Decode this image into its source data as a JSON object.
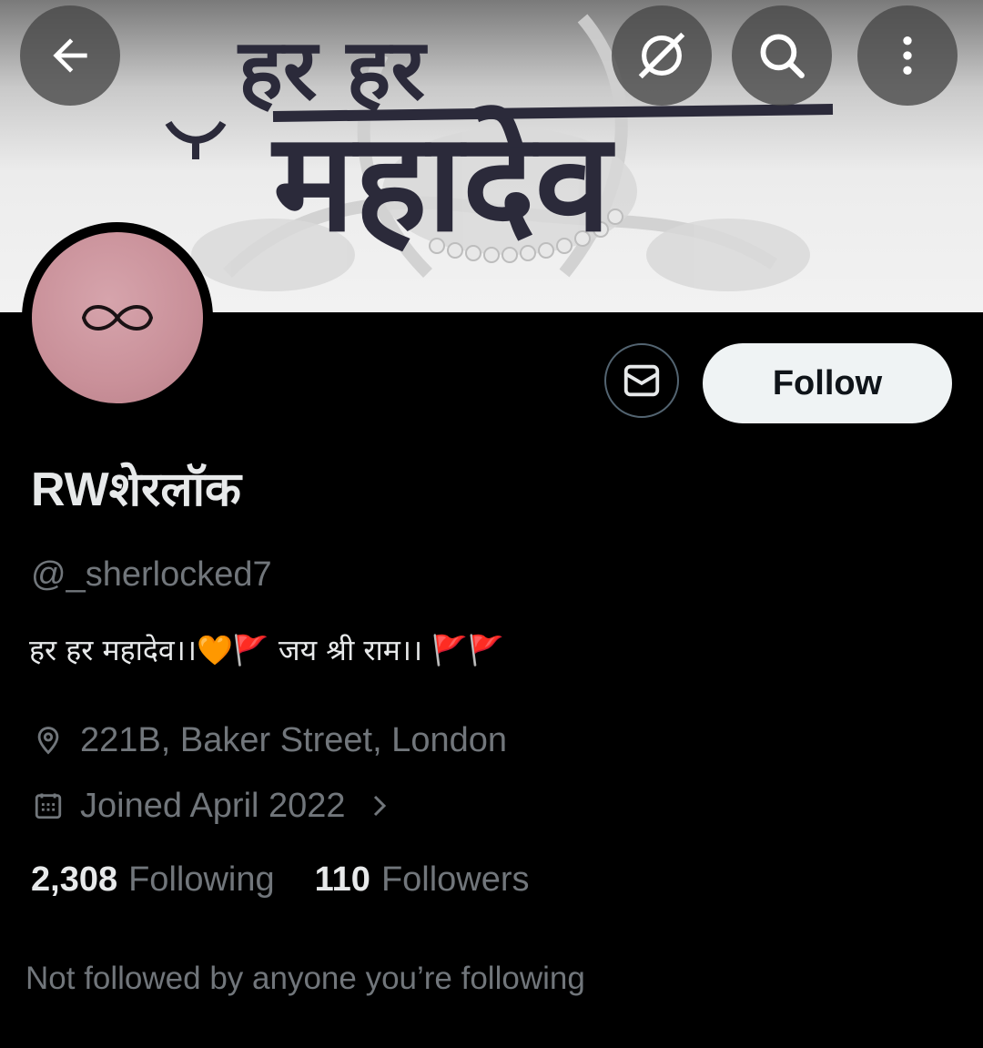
{
  "banner": {
    "line1": "हर हर",
    "line2": "महादेव"
  },
  "toolbar": {
    "back_icon": "arrow-left-icon",
    "grok_icon": "grok-icon",
    "search_icon": "search-icon",
    "more_icon": "more-vertical-icon"
  },
  "profile": {
    "avatar_glyph": "∞",
    "display_name": "RWशेरलॉक",
    "handle": "@_sherlocked7",
    "bio": "हर हर महादेव।।🧡🚩  जय श्री राम।। 🚩🚩",
    "location": "221B, Baker Street, London",
    "joined": "Joined April 2022",
    "follow_label": "Follow",
    "following_count": "2,308",
    "following_label": "Following",
    "followers_count": "110",
    "followers_label": "Followers",
    "not_followed_text": "Not followed by anyone you’re following"
  },
  "colors": {
    "background": "#000000",
    "primary_text": "#e7e9ea",
    "secondary_text": "#71767b",
    "follow_button_bg": "#eff3f4",
    "avatar_pink": "#c99099"
  }
}
